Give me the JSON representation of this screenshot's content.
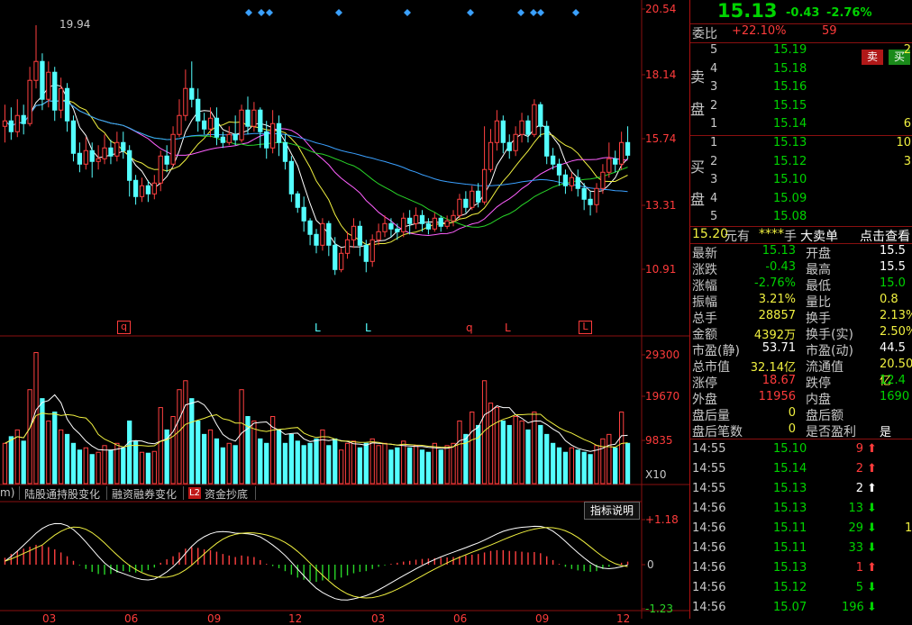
{
  "price_axis": {
    "labels": [
      "20.54",
      "18.14",
      "15.74",
      "13.31",
      "10.91"
    ]
  },
  "high_marker": "19.94",
  "signal_markers": [
    "q",
    "L",
    "L",
    "q",
    "L",
    "L"
  ],
  "volume_axis": {
    "labels": [
      "29300",
      "19670",
      "9835"
    ],
    "unit": "X10"
  },
  "macd_axis": {
    "labels": [
      "+1.18",
      "0",
      "-1.23"
    ]
  },
  "date_axis": [
    "03",
    "06",
    "09",
    "12",
    "03",
    "06",
    "09",
    "12"
  ],
  "indicator_tabs": {
    "partial": "m)",
    "tab1": "陆股通持股变化",
    "tab2": "融资融券变化",
    "l2_badge": "L2",
    "tab3": "资金抄底"
  },
  "explain_button": "指标说明",
  "chart_data": {
    "type": "candlestick",
    "title": "",
    "ylim": [
      10.0,
      20.6
    ],
    "price_ticks": [
      20.54,
      18.14,
      15.74,
      13.31,
      10.91
    ],
    "candles": [
      [
        16.2,
        16.4,
        17.0,
        15.6
      ],
      [
        16.4,
        16.0,
        16.9,
        15.7
      ],
      [
        16.0,
        16.6,
        17.2,
        15.8
      ],
      [
        16.6,
        16.3,
        17.0,
        15.9
      ],
      [
        16.3,
        17.9,
        18.4,
        16.2
      ],
      [
        17.9,
        18.6,
        19.94,
        17.6
      ],
      [
        18.6,
        17.2,
        18.9,
        16.8
      ],
      [
        17.2,
        18.2,
        18.6,
        16.9
      ],
      [
        18.2,
        16.8,
        18.4,
        16.4
      ],
      [
        16.8,
        17.6,
        18.0,
        16.5
      ],
      [
        17.6,
        16.4,
        17.8,
        16.0
      ],
      [
        16.4,
        15.2,
        16.6,
        14.9
      ],
      [
        15.2,
        14.8,
        15.6,
        14.5
      ],
      [
        14.8,
        15.3,
        15.8,
        14.6
      ],
      [
        15.3,
        14.9,
        15.6,
        14.3
      ],
      [
        14.9,
        15.0,
        15.5,
        14.6
      ],
      [
        15.0,
        15.4,
        15.9,
        14.8
      ],
      [
        15.4,
        15.1,
        15.7,
        14.8
      ],
      [
        15.1,
        15.6,
        16.0,
        14.9
      ],
      [
        15.6,
        15.3,
        16.0,
        15.0
      ],
      [
        15.3,
        14.2,
        15.5,
        13.6
      ],
      [
        14.2,
        13.6,
        14.4,
        13.3
      ],
      [
        13.6,
        14.0,
        14.3,
        13.4
      ],
      [
        14.0,
        13.7,
        14.2,
        13.4
      ],
      [
        13.7,
        14.1,
        14.4,
        13.5
      ],
      [
        14.1,
        15.1,
        15.3,
        13.8
      ],
      [
        15.1,
        14.8,
        15.5,
        14.5
      ],
      [
        14.8,
        15.9,
        16.2,
        14.7
      ],
      [
        15.9,
        16.6,
        17.2,
        15.8
      ],
      [
        16.6,
        17.6,
        18.3,
        16.4
      ],
      [
        17.6,
        17.2,
        18.6,
        16.9
      ],
      [
        17.2,
        16.4,
        17.6,
        16.0
      ],
      [
        16.4,
        16.1,
        16.7,
        15.9
      ],
      [
        16.1,
        16.5,
        16.9,
        15.8
      ],
      [
        16.5,
        15.8,
        16.9,
        15.5
      ],
      [
        15.8,
        15.6,
        16.0,
        15.4
      ],
      [
        15.6,
        15.9,
        16.2,
        15.5
      ],
      [
        15.9,
        15.7,
        16.6,
        15.5
      ],
      [
        15.7,
        16.8,
        17.0,
        15.6
      ],
      [
        16.8,
        16.2,
        17.3,
        15.9
      ],
      [
        16.2,
        16.8,
        17.1,
        16.0
      ],
      [
        16.8,
        16.0,
        16.9,
        15.4
      ],
      [
        16.0,
        15.4,
        16.4,
        15.0
      ],
      [
        15.4,
        16.3,
        16.8,
        15.2
      ],
      [
        16.3,
        15.6,
        16.6,
        15.1
      ],
      [
        15.6,
        14.9,
        15.9,
        14.6
      ],
      [
        14.9,
        13.7,
        15.1,
        13.4
      ],
      [
        13.7,
        13.2,
        13.8,
        13.0
      ],
      [
        13.2,
        12.7,
        13.6,
        12.3
      ],
      [
        12.7,
        12.2,
        12.8,
        11.8
      ],
      [
        12.2,
        11.8,
        12.4,
        11.5
      ],
      [
        11.8,
        12.6,
        12.8,
        11.6
      ],
      [
        12.6,
        11.8,
        12.7,
        11.4
      ],
      [
        11.8,
        10.9,
        12.1,
        10.7
      ],
      [
        10.9,
        11.5,
        11.7,
        10.8
      ],
      [
        11.5,
        12.0,
        12.3,
        11.3
      ],
      [
        12.0,
        12.5,
        12.8,
        11.7
      ],
      [
        12.5,
        11.8,
        12.7,
        11.4
      ],
      [
        11.8,
        11.2,
        12.0,
        10.8
      ],
      [
        11.2,
        12.0,
        12.2,
        11.0
      ],
      [
        12.0,
        12.3,
        12.6,
        11.8
      ],
      [
        12.3,
        12.6,
        12.9,
        12.1
      ],
      [
        12.6,
        12.4,
        12.8,
        12.1
      ],
      [
        12.4,
        12.3,
        12.6,
        12.0
      ],
      [
        12.3,
        12.8,
        13.0,
        12.1
      ],
      [
        12.8,
        12.6,
        13.1,
        12.2
      ],
      [
        12.6,
        12.9,
        13.2,
        12.4
      ],
      [
        12.9,
        12.6,
        13.1,
        12.3
      ],
      [
        12.6,
        12.4,
        12.8,
        12.2
      ],
      [
        12.4,
        12.8,
        13.0,
        12.3
      ],
      [
        12.8,
        12.5,
        12.9,
        12.3
      ],
      [
        12.5,
        12.7,
        12.9,
        12.4
      ],
      [
        12.7,
        12.9,
        13.1,
        12.5
      ],
      [
        12.9,
        13.5,
        13.7,
        12.8
      ],
      [
        13.5,
        13.2,
        13.8,
        13.0
      ],
      [
        13.2,
        13.8,
        14.0,
        13.1
      ],
      [
        13.8,
        13.4,
        14.1,
        13.2
      ],
      [
        13.4,
        14.6,
        16.2,
        13.3
      ],
      [
        14.6,
        15.6,
        16.1,
        14.5
      ],
      [
        15.6,
        16.4,
        16.8,
        15.3
      ],
      [
        16.4,
        15.6,
        16.6,
        15.2
      ],
      [
        15.6,
        15.3,
        15.9,
        15.0
      ],
      [
        15.3,
        15.9,
        16.2,
        15.1
      ],
      [
        15.9,
        16.4,
        16.7,
        15.6
      ],
      [
        16.4,
        15.9,
        16.6,
        15.6
      ],
      [
        15.9,
        17.0,
        17.2,
        15.8
      ],
      [
        17.0,
        16.2,
        17.1,
        15.8
      ],
      [
        16.2,
        15.1,
        16.4,
        14.8
      ],
      [
        15.1,
        14.8,
        15.4,
        14.6
      ],
      [
        14.8,
        14.4,
        15.0,
        14.0
      ],
      [
        14.4,
        14.0,
        14.6,
        13.7
      ],
      [
        14.0,
        14.3,
        14.5,
        13.8
      ],
      [
        14.3,
        13.9,
        14.6,
        13.6
      ],
      [
        13.9,
        13.5,
        14.1,
        13.1
      ],
      [
        13.5,
        13.3,
        13.8,
        12.9
      ],
      [
        13.3,
        13.9,
        14.1,
        13.0
      ],
      [
        13.9,
        14.5,
        14.8,
        13.7
      ],
      [
        14.5,
        15.0,
        15.6,
        14.3
      ],
      [
        15.0,
        14.8,
        15.3,
        14.5
      ],
      [
        14.8,
        15.6,
        16.0,
        14.6
      ],
      [
        15.6,
        15.13,
        16.2,
        15.0
      ]
    ],
    "volume_ylim": [
      0,
      30000
    ],
    "volume_ticks": [
      29300,
      19670,
      9835
    ],
    "volume": [
      9000,
      10500,
      12000,
      9500,
      21000,
      29300,
      19000,
      14000,
      16000,
      12000,
      11000,
      9000,
      7500,
      8000,
      6500,
      7000,
      8500,
      7500,
      9000,
      8000,
      14000,
      9500,
      7000,
      6800,
      7200,
      17000,
      12000,
      15000,
      21000,
      23000,
      19000,
      14000,
      11000,
      12000,
      10000,
      8000,
      9000,
      8500,
      21000,
      15000,
      14000,
      10000,
      9000,
      15000,
      12000,
      9000,
      11000,
      9500,
      8500,
      9000,
      10000,
      12000,
      8500,
      10000,
      7500,
      9000,
      9500,
      8000,
      9000,
      10000,
      8500,
      9000,
      7500,
      8000,
      9500,
      8000,
      8500,
      7500,
      7000,
      9000,
      7500,
      8500,
      9000,
      14000,
      11000,
      16000,
      13000,
      23000,
      18000,
      17000,
      14000,
      13000,
      15000,
      14000,
      12000,
      16000,
      13000,
      11000,
      9000,
      8000,
      7000,
      8000,
      7500,
      7000,
      6500,
      8500,
      10000,
      11000,
      8000,
      16000,
      9000
    ],
    "macd_ylim": [
      -1.23,
      1.18
    ],
    "macd_ticks": [
      1.18,
      0,
      -1.23
    ],
    "macd_hist": [
      0.18,
      0.28,
      0.35,
      0.42,
      0.47,
      0.52,
      0.5,
      0.46,
      0.4,
      0.32,
      0.22,
      0.1,
      -0.02,
      -0.12,
      -0.2,
      -0.26,
      -0.28,
      -0.26,
      -0.22,
      -0.18,
      -0.2,
      -0.22,
      -0.2,
      -0.15,
      -0.08,
      0.05,
      0.14,
      0.22,
      0.32,
      0.42,
      0.46,
      0.44,
      0.4,
      0.38,
      0.34,
      0.28,
      0.24,
      0.2,
      0.24,
      0.22,
      0.2,
      0.12,
      0.02,
      -0.04,
      -0.1,
      -0.18,
      -0.28,
      -0.36,
      -0.42,
      -0.46,
      -0.48,
      -0.44,
      -0.42,
      -0.42,
      -0.36,
      -0.3,
      -0.24,
      -0.2,
      -0.18,
      -0.12,
      -0.06,
      -0.02,
      0.02,
      0.05,
      0.08,
      0.1,
      0.13,
      0.15,
      0.16,
      0.17,
      0.18,
      0.19,
      0.2,
      0.22,
      0.24,
      0.26,
      0.28,
      0.32,
      0.36,
      0.38,
      0.38,
      0.36,
      0.35,
      0.34,
      0.32,
      0.33,
      0.3,
      0.22,
      0.12,
      0.02,
      -0.06,
      -0.12,
      -0.16,
      -0.18,
      -0.2,
      -0.18,
      -0.12,
      -0.06,
      0.0,
      0.05,
      0.08
    ]
  },
  "quote": {
    "price": "15.13",
    "change": "-0.43",
    "change_pct": "-2.76%",
    "weibi_label": "委比",
    "weibi_value": "+22.10%",
    "weicha": "59",
    "buy_btn": "买",
    "sell_btn": "卖",
    "sell_side": "卖盘",
    "buy_side": "买盘",
    "asks": [
      {
        "level": "5",
        "price": "15.19",
        "vol": "2"
      },
      {
        "level": "4",
        "price": "15.18",
        "vol": ""
      },
      {
        "level": "3",
        "price": "15.16",
        "vol": ""
      },
      {
        "level": "2",
        "price": "15.15",
        "vol": ""
      },
      {
        "level": "1",
        "price": "15.14",
        "vol": "6"
      }
    ],
    "bids": [
      {
        "level": "1",
        "price": "15.13",
        "vol": "10"
      },
      {
        "level": "2",
        "price": "15.12",
        "vol": "3"
      },
      {
        "level": "3",
        "price": "15.10",
        "vol": ""
      },
      {
        "level": "4",
        "price": "15.09",
        "vol": ""
      },
      {
        "level": "5",
        "price": "15.08",
        "vol": ""
      }
    ],
    "bigorder": {
      "price": "15.20",
      "you": "元有",
      "stars": "****",
      "unit": "手",
      "label": "大卖单",
      "link": "点击查看"
    },
    "stats": [
      {
        "l1": "最新",
        "v1": "15.13",
        "c1": "grn",
        "l2": "开盘",
        "v2": "15.5",
        "c2": "wht"
      },
      {
        "l1": "涨跌",
        "v1": "-0.43",
        "c1": "grn",
        "l2": "最高",
        "v2": "15.5",
        "c2": "wht"
      },
      {
        "l1": "涨幅",
        "v1": "-2.76%",
        "c1": "grn",
        "l2": "最低",
        "v2": "15.0",
        "c2": "grn"
      },
      {
        "l1": "振幅",
        "v1": "3.21%",
        "c1": "yel",
        "l2": "量比",
        "v2": "0.8",
        "c2": "yel"
      },
      {
        "l1": "总手",
        "v1": "28857",
        "c1": "yel",
        "l2": "换手",
        "v2": "2.13%",
        "c2": "yel"
      },
      {
        "l1": "金额",
        "v1": "4392万",
        "c1": "yel",
        "l2": "换手(实)",
        "v2": "2.50%",
        "c2": "yel"
      },
      {
        "l1": "市盈(静)",
        "v1": "53.71",
        "c1": "wht",
        "l2": "市盈(动)",
        "v2": "44.5",
        "c2": "wht"
      },
      {
        "l1": "总市值",
        "v1": "32.14亿",
        "c1": "yel",
        "l2": "流通值",
        "v2": "20.50亿",
        "c2": "yel"
      },
      {
        "l1": "涨停",
        "v1": "18.67",
        "c1": "red",
        "l2": "跌停",
        "v2": "12.4",
        "c2": "grn"
      },
      {
        "l1": "外盘",
        "v1": "11956",
        "c1": "red",
        "l2": "内盘",
        "v2": "1690",
        "c2": "grn"
      },
      {
        "l1": "盘后量",
        "v1": "0",
        "c1": "yel",
        "l2": "盘后额",
        "v2": "",
        "c2": "yel"
      },
      {
        "l1": "盘后笔数",
        "v1": "0",
        "c1": "yel",
        "l2": "是否盈利",
        "v2": "是",
        "c2": "wht"
      }
    ],
    "ticks": [
      {
        "t": "14:55",
        "p": "15.10",
        "pc": "grn",
        "v": "9",
        "vc": "red",
        "dir": "up",
        "ac": "red",
        "x": ""
      },
      {
        "t": "14:55",
        "p": "15.14",
        "pc": "grn",
        "v": "2",
        "vc": "red",
        "dir": "up",
        "ac": "red",
        "x": ""
      },
      {
        "t": "14:55",
        "p": "15.13",
        "pc": "grn",
        "v": "2",
        "vc": "wht",
        "dir": "up",
        "ac": "wht",
        "x": ""
      },
      {
        "t": "14:56",
        "p": "15.13",
        "pc": "grn",
        "v": "13",
        "vc": "grn",
        "dir": "down",
        "ac": "grn",
        "x": ""
      },
      {
        "t": "14:56",
        "p": "15.11",
        "pc": "grn",
        "v": "29",
        "vc": "grn",
        "dir": "down",
        "ac": "grn",
        "x": "1"
      },
      {
        "t": "14:56",
        "p": "15.11",
        "pc": "grn",
        "v": "33",
        "vc": "grn",
        "dir": "down",
        "ac": "grn",
        "x": ""
      },
      {
        "t": "14:56",
        "p": "15.13",
        "pc": "grn",
        "v": "1",
        "vc": "red",
        "dir": "up",
        "ac": "red",
        "x": ""
      },
      {
        "t": "14:56",
        "p": "15.12",
        "pc": "grn",
        "v": "5",
        "vc": "grn",
        "dir": "down",
        "ac": "grn",
        "x": ""
      },
      {
        "t": "14:56",
        "p": "15.07",
        "pc": "grn",
        "v": "196",
        "vc": "grn",
        "dir": "down",
        "ac": "grn",
        "x": ""
      }
    ]
  },
  "colors": {
    "up": "#ff4040",
    "down": "#54ffff",
    "grid": "#8a1010",
    "ma1": "#ffffff",
    "ma2": "#f0f040",
    "ma3": "#ff60ff",
    "ma4": "#28d428",
    "ma5": "#3aa0ff"
  }
}
